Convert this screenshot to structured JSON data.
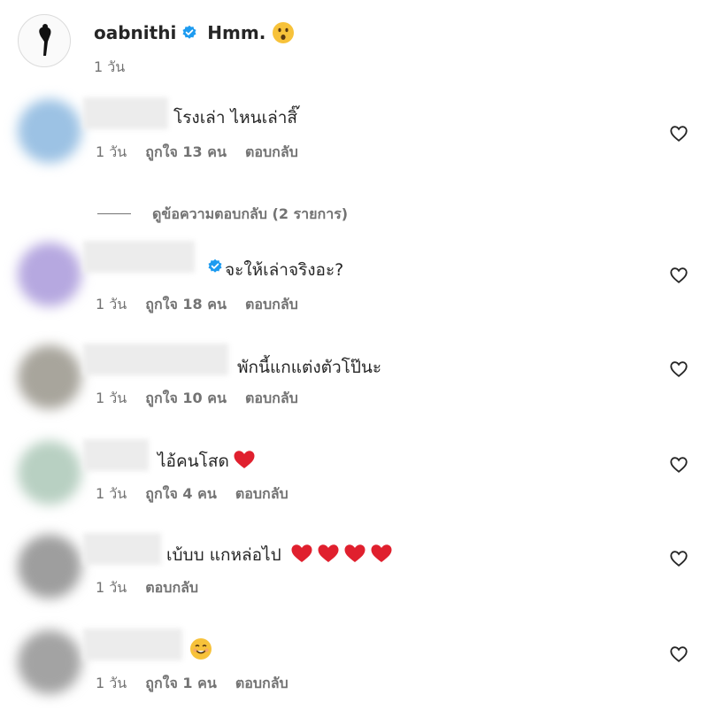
{
  "post": {
    "username": "oabnithi",
    "caption": "Hmm.",
    "emoji": "hushed-face-emoji",
    "time": "1 วัน"
  },
  "view_replies": "ดูข้อความตอบกลับ (2 รายการ)",
  "comments": [
    {
      "text": "โรงเล่า ไหนเล่าสิ๊",
      "time": "1 วัน",
      "likes": "ถูกใจ 13 คน",
      "reply": "ตอบกลับ",
      "verified": false
    },
    {
      "text": "จะให้เล่าจริงอะ?",
      "time": "1 วัน",
      "likes": "ถูกใจ 18 คน",
      "reply": "ตอบกลับ",
      "verified": true
    },
    {
      "text": "พักนี้แกแต่งตัวโป๊นะ",
      "time": "1 วัน",
      "likes": "ถูกใจ 10 คน",
      "reply": "ตอบกลับ",
      "verified": false
    },
    {
      "text": "ไอ้คนโสด",
      "time": "1 วัน",
      "likes": "ถูกใจ 4 คน",
      "reply": "ตอบกลับ",
      "verified": false,
      "hearts": 1
    },
    {
      "text": "เบ้บบ แกหล่อไป",
      "time": "1 วัน",
      "likes": "",
      "reply": "ตอบกลับ",
      "verified": false,
      "hearts": 4
    },
    {
      "text": "",
      "time": "1 วัน",
      "likes": "ถูกใจ 1 คน",
      "reply": "ตอบกลับ",
      "verified": false,
      "emoji": "smiling-face-emoji"
    }
  ],
  "colors": {
    "verified": "#1d9bf0",
    "heart_red": "#e0202e",
    "muted": "#737373"
  }
}
